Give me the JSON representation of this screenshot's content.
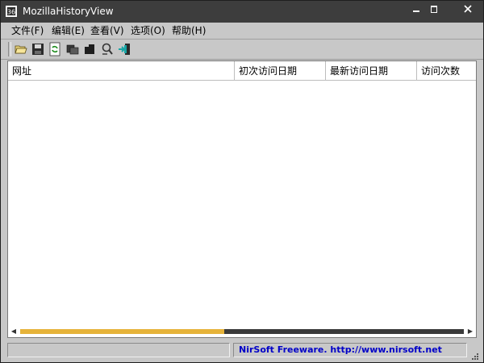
{
  "window": {
    "title": "MozillaHistoryView"
  },
  "menu": {
    "items": [
      {
        "label": "文件(F)"
      },
      {
        "label": "编辑(E)"
      },
      {
        "label": "查看(V)"
      },
      {
        "label": "选项(O)"
      },
      {
        "label": "帮助(H)"
      }
    ]
  },
  "toolbar": {
    "buttons": [
      {
        "icon": "open-folder-icon"
      },
      {
        "icon": "save-disk-icon"
      },
      {
        "icon": "refresh-icon"
      },
      {
        "icon": "copy-icon"
      },
      {
        "icon": "html-report-icon"
      },
      {
        "icon": "find-icon"
      },
      {
        "icon": "exit-icon"
      }
    ]
  },
  "list": {
    "columns": [
      {
        "label": "网址"
      },
      {
        "label": "初次访问日期"
      },
      {
        "label": "最新访问日期"
      },
      {
        "label": "访问次数"
      }
    ],
    "rows": [],
    "hscroll_position": 0.46
  },
  "status": {
    "left_text": "",
    "link_text": "NirSoft Freeware.  http://www.nirsoft.net"
  },
  "colors": {
    "titlebar": "#3d3d3d",
    "chrome": "#c8c8c8",
    "scroll_thumb": "#e6b33a",
    "link": "#0000c8"
  }
}
